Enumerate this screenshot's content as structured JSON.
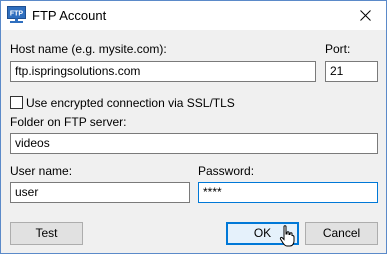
{
  "window": {
    "title": "FTP Account",
    "app_icon": "ftp-icon",
    "app_icon_text": "FTP",
    "close_icon": "close-icon"
  },
  "form": {
    "host_label": "Host name (e.g. mysite.com):",
    "host_value": "ftp.ispringsolutions.com",
    "port_label": "Port:",
    "port_value": "21",
    "ssl_label": "Use encrypted connection via SSL/TLS",
    "ssl_checked": false,
    "folder_label": "Folder on FTP server:",
    "folder_value": "videos",
    "user_label": "User name:",
    "user_value": "user",
    "password_label": "Password:",
    "password_value": "****"
  },
  "buttons": {
    "test": "Test",
    "ok": "OK",
    "cancel": "Cancel"
  },
  "colors": {
    "accent": "#0078d7",
    "window_border": "#5b8ac9",
    "dialog_bg": "#f0f0f0"
  }
}
